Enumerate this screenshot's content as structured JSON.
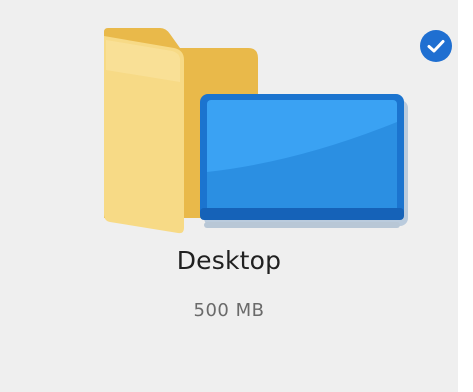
{
  "folder": {
    "name": "Desktop",
    "size": "500 MB",
    "selected": true,
    "icon": "desktop-folder-icon"
  },
  "colors": {
    "tile_background": "#efefef",
    "check_accent": "#1f6fd1",
    "folder_yellow": "#f6d67a",
    "monitor_blue": "#2a8fe6"
  }
}
